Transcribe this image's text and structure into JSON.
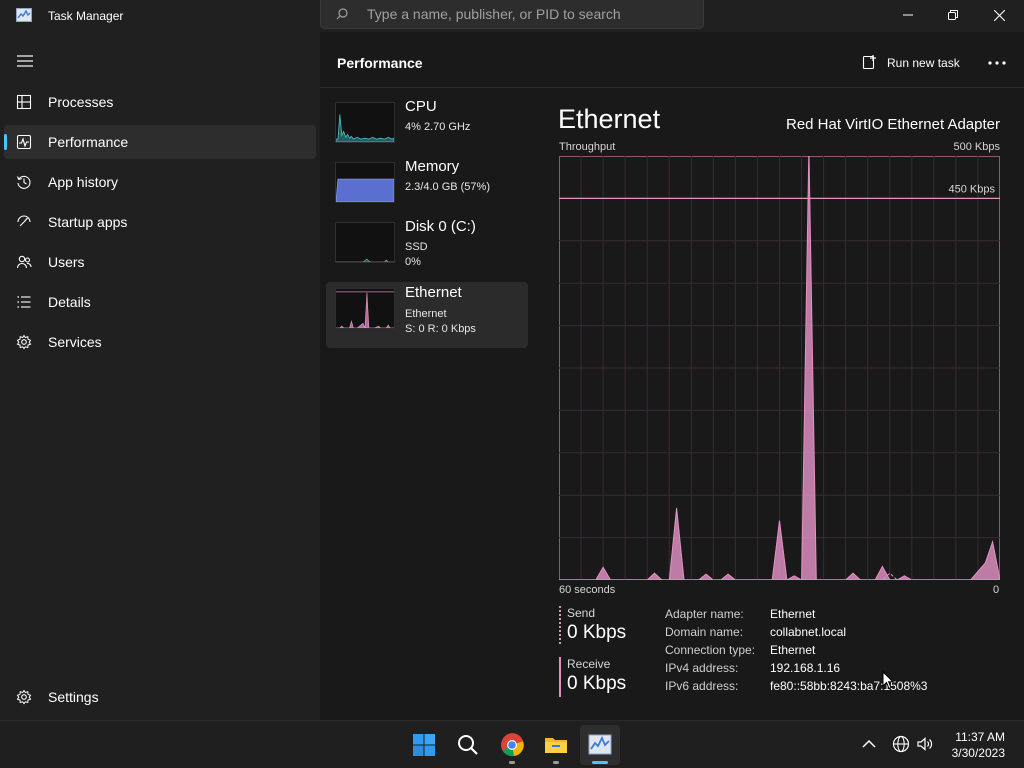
{
  "window": {
    "title": "Task Manager",
    "icon": "task-manager-icon",
    "search_placeholder": "Type a name, publisher, or PID to search",
    "controls": [
      "minimize-icon",
      "restore-icon",
      "close-icon"
    ]
  },
  "sidebar": {
    "menu_icon": "hamburger-icon",
    "items": [
      {
        "label": "Processes",
        "icon": "processes-icon",
        "selected": false
      },
      {
        "label": "Performance",
        "icon": "performance-icon",
        "selected": true
      },
      {
        "label": "App history",
        "icon": "app-history-icon",
        "selected": false
      },
      {
        "label": "Startup apps",
        "icon": "startup-apps-icon",
        "selected": false
      },
      {
        "label": "Users",
        "icon": "users-icon",
        "selected": false
      },
      {
        "label": "Details",
        "icon": "details-icon",
        "selected": false
      },
      {
        "label": "Services",
        "icon": "services-icon",
        "selected": false
      }
    ],
    "settings": {
      "label": "Settings",
      "icon": "settings-icon"
    }
  },
  "header": {
    "title": "Performance",
    "run_new_task": "Run new task",
    "more_icon": "more-options-icon"
  },
  "resources": [
    {
      "name": "CPU",
      "sub1": "4%  2.70 GHz",
      "color": "#4cc2c4"
    },
    {
      "name": "Memory",
      "sub1": "2.3/4.0 GB (57%)",
      "color": "#6b7fdc"
    },
    {
      "name": "Disk 0 (C:)",
      "sub1": "SSD",
      "sub2": "0%",
      "color": "#3fae7a"
    },
    {
      "name": "Ethernet",
      "sub1": "Ethernet",
      "sub2": "S: 0  R: 0 Kbps",
      "color": "#d784b8",
      "selected": true
    }
  ],
  "detail": {
    "title": "Ethernet",
    "adapter": "Red Hat VirtIO Ethernet Adapter",
    "throughput_label": "Throughput",
    "max_label": "500 Kbps",
    "line_label": "450 Kbps",
    "time_label": "60 seconds",
    "zero_label": "0",
    "send": {
      "label": "Send",
      "value": "0 Kbps"
    },
    "receive": {
      "label": "Receive",
      "value": "0 Kbps"
    },
    "properties": [
      {
        "key": "Adapter name:",
        "value": "Ethernet"
      },
      {
        "key": "Domain name:",
        "value": "collabnet.local"
      },
      {
        "key": "Connection type:",
        "value": "Ethernet"
      },
      {
        "key": "IPv4 address:",
        "value": "192.168.1.16"
      },
      {
        "key": "IPv6 address:",
        "value": "fe80::58bb:8243:ba7:1508%3"
      }
    ]
  },
  "chart_data": {
    "type": "area",
    "title": "Throughput",
    "x": [
      60,
      59,
      58,
      57,
      56,
      55,
      54,
      53,
      52,
      51,
      50,
      49,
      48,
      47,
      46,
      45,
      44,
      43,
      42,
      41,
      40,
      39,
      38,
      37,
      36,
      35,
      34,
      33,
      32,
      31,
      30,
      29,
      28,
      27,
      26,
      25,
      24,
      23,
      22,
      21,
      20,
      19,
      18,
      17,
      16,
      15,
      14,
      13,
      12,
      11,
      10,
      9,
      8,
      7,
      6,
      5,
      4,
      3,
      2,
      1,
      0
    ],
    "xlabel": "60 seconds",
    "series": [
      {
        "name": "Receive",
        "values": [
          0,
          0,
          0,
          0,
          0,
          0,
          15,
          0,
          0,
          0,
          0,
          0,
          0,
          8,
          0,
          0,
          85,
          0,
          0,
          0,
          7,
          0,
          0,
          7,
          0,
          0,
          0,
          0,
          0,
          0,
          70,
          0,
          5,
          0,
          510,
          0,
          0,
          0,
          0,
          0,
          8,
          0,
          0,
          0,
          16,
          0,
          0,
          5,
          0,
          0,
          0,
          0,
          0,
          0,
          0,
          0,
          0,
          10,
          20,
          45,
          0
        ]
      },
      {
        "name": "Send",
        "values": [
          0,
          0,
          0,
          0,
          0,
          0,
          0,
          0,
          0,
          0,
          0,
          0,
          0,
          0,
          0,
          0,
          0,
          0,
          0,
          0,
          0,
          0,
          0,
          0,
          0,
          0,
          0,
          0,
          0,
          0,
          0,
          0,
          0,
          0,
          0,
          0,
          0,
          0,
          0,
          0,
          0,
          0,
          0,
          0,
          0,
          8,
          0,
          0,
          0,
          0,
          0,
          0,
          0,
          0,
          0,
          0,
          0,
          0,
          0,
          0,
          0
        ]
      }
    ],
    "ylim": [
      0,
      500
    ],
    "reference_line": 450,
    "grid": true,
    "color": "#e391c4"
  },
  "taskbar": {
    "apps": [
      {
        "name": "start-button",
        "icon": "windows-start-icon",
        "running": false
      },
      {
        "name": "search-button",
        "icon": "search-icon",
        "running": false
      },
      {
        "name": "chrome-button",
        "icon": "chrome-icon",
        "running": true
      },
      {
        "name": "file-explorer-button",
        "icon": "folder-icon",
        "running": true
      },
      {
        "name": "task-manager-button",
        "icon": "task-manager-icon",
        "running": true,
        "active": true
      }
    ],
    "tray": [
      "chevron-up-icon",
      "network-icon",
      "volume-icon"
    ],
    "time": "11:37 AM",
    "date": "3/30/2023"
  }
}
